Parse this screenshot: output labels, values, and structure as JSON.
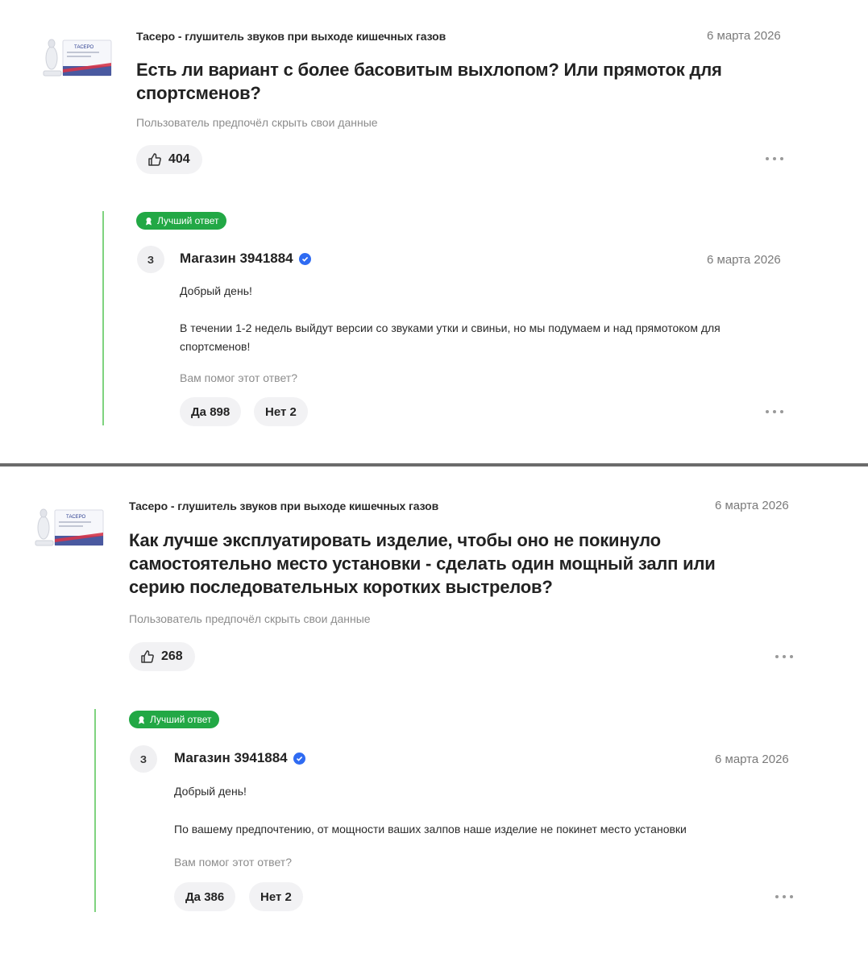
{
  "questions": [
    {
      "product": "Тасеро - глушитель звуков при выходе кишечных газов",
      "product_image_text": "ТАСЕРО",
      "date": "6 марта 2026",
      "question": "Есть ли вариант с более басовитым выхлопом? Или прямоток для спортсменов?",
      "author": "Пользователь предпочёл скрыть свои данные",
      "likes": "404",
      "answer": {
        "badge": "Лучший ответ",
        "avatar_letter": "З",
        "seller": "Магазин 3941884",
        "date": "6 марта 2026",
        "greeting": "Добрый день!",
        "text": "В течении 1-2 недель выйдут версии со звуками утки и свиньи, но мы подумаем и над прямотоком для спортсменов!",
        "helpful_label": "Вам помог этот ответ?",
        "yes_label": "Да 898",
        "no_label": "Нет 2"
      }
    },
    {
      "product": "Тасеро - глушитель звуков при выходе кишечных газов",
      "product_image_text": "ТАСЕРО",
      "date": "6 марта 2026",
      "question": "Как лучше эксплуатировать изделие, чтобы оно не покинуло самостоятельно место установки - сделать один мощный залп или серию последовательных коротких выстрелов?",
      "author": "Пользователь предпочёл скрыть свои данные",
      "likes": "268",
      "answer": {
        "badge": "Лучший ответ",
        "avatar_letter": "З",
        "seller": "Магазин 3941884",
        "date": "6 марта 2026",
        "greeting": "Добрый день!",
        "text": "По вашему предпочтению, от мощности ваших залпов наше изделие не покинет место установки",
        "helpful_label": "Вам помог этот ответ?",
        "yes_label": "Да 386",
        "no_label": "Нет 2"
      }
    }
  ],
  "colors": {
    "best_badge": "#22a845",
    "answer_line": "#7fd37f",
    "verified": "#2f6bf2",
    "divider": "#6b6b6b",
    "pill_bg": "#f2f2f4"
  },
  "icons": {
    "like": "thumbs-up-icon",
    "best": "award-icon",
    "verified": "verified-check-icon",
    "more": "more-dots-icon"
  }
}
